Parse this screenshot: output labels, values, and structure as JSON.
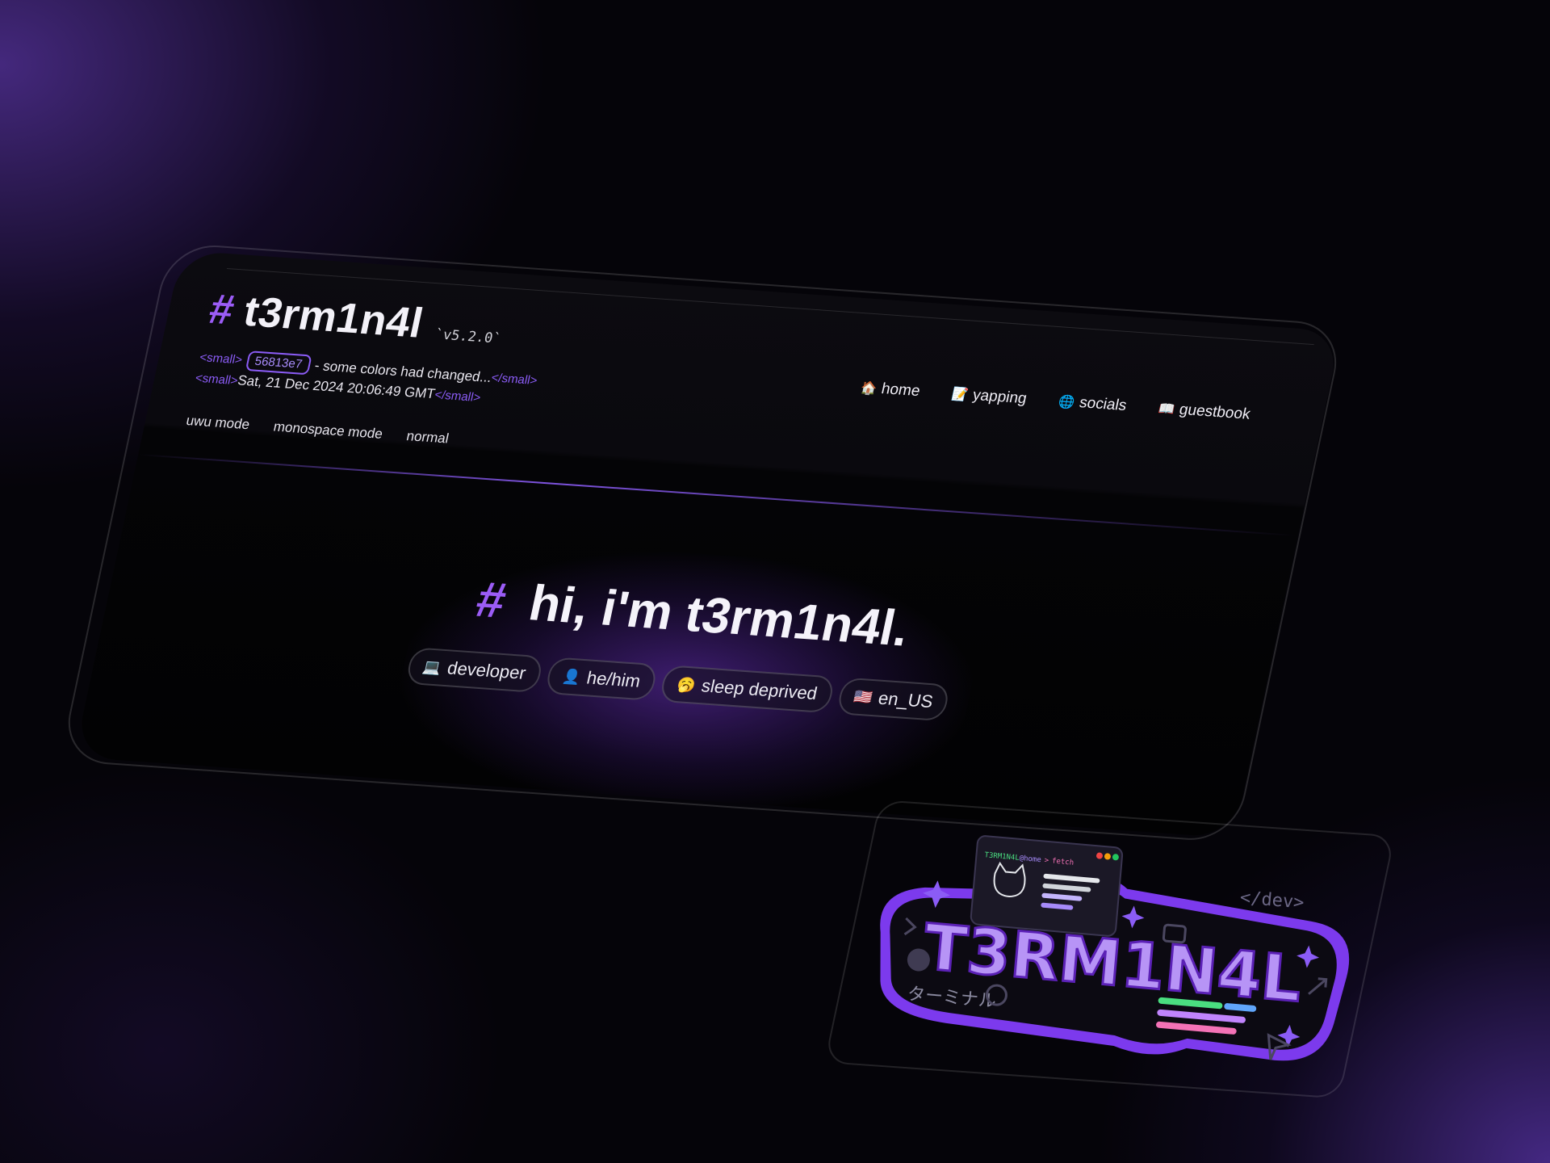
{
  "site": {
    "hash": "#",
    "title": "t3rm1n4l",
    "version": "`v5.2.0`"
  },
  "meta": {
    "small_open": "<small>",
    "small_close": "</small>",
    "commit": "56813e7",
    "commit_message": "- some colors had changed...",
    "timestamp": "Sat, 21 Dec 2024 20:06:49 GMT"
  },
  "modes": [
    "uwu mode",
    "monospace mode",
    "normal"
  ],
  "nav": [
    {
      "icon": "🏠",
      "icon_name": "house-icon",
      "label": "home"
    },
    {
      "icon": "📝",
      "icon_name": "memo-icon",
      "label": "yapping"
    },
    {
      "icon": "🌐",
      "icon_name": "globe-icon",
      "label": "socials"
    },
    {
      "icon": "📖",
      "icon_name": "book-icon",
      "label": "guestbook"
    }
  ],
  "hero": {
    "hash": "#",
    "title": "hi, i'm t3rm1n4l."
  },
  "pills": [
    {
      "icon": "💻",
      "icon_name": "laptop-icon",
      "label": "developer"
    },
    {
      "icon": "👤",
      "icon_name": "person-icon",
      "label": "he/him"
    },
    {
      "icon": "🥱",
      "icon_name": "yawning-face-icon",
      "label": "sleep deprived"
    },
    {
      "icon": "🇺🇸",
      "icon_name": "us-flag-icon",
      "label": "en_US"
    }
  ],
  "sticker": {
    "prompt_user": "T3RM1N4L",
    "prompt_host": "@home",
    "prompt_arrow": ">",
    "prompt_cmd": "fetch",
    "logo_text": "T3RM1N4L",
    "dev_tag": "</dev>",
    "katakana": "ターミナル"
  },
  "colors": {
    "accent": "#8b5cf6",
    "accent_light": "#a78bfa",
    "background": "#050409",
    "text": "#f3f1f8"
  }
}
